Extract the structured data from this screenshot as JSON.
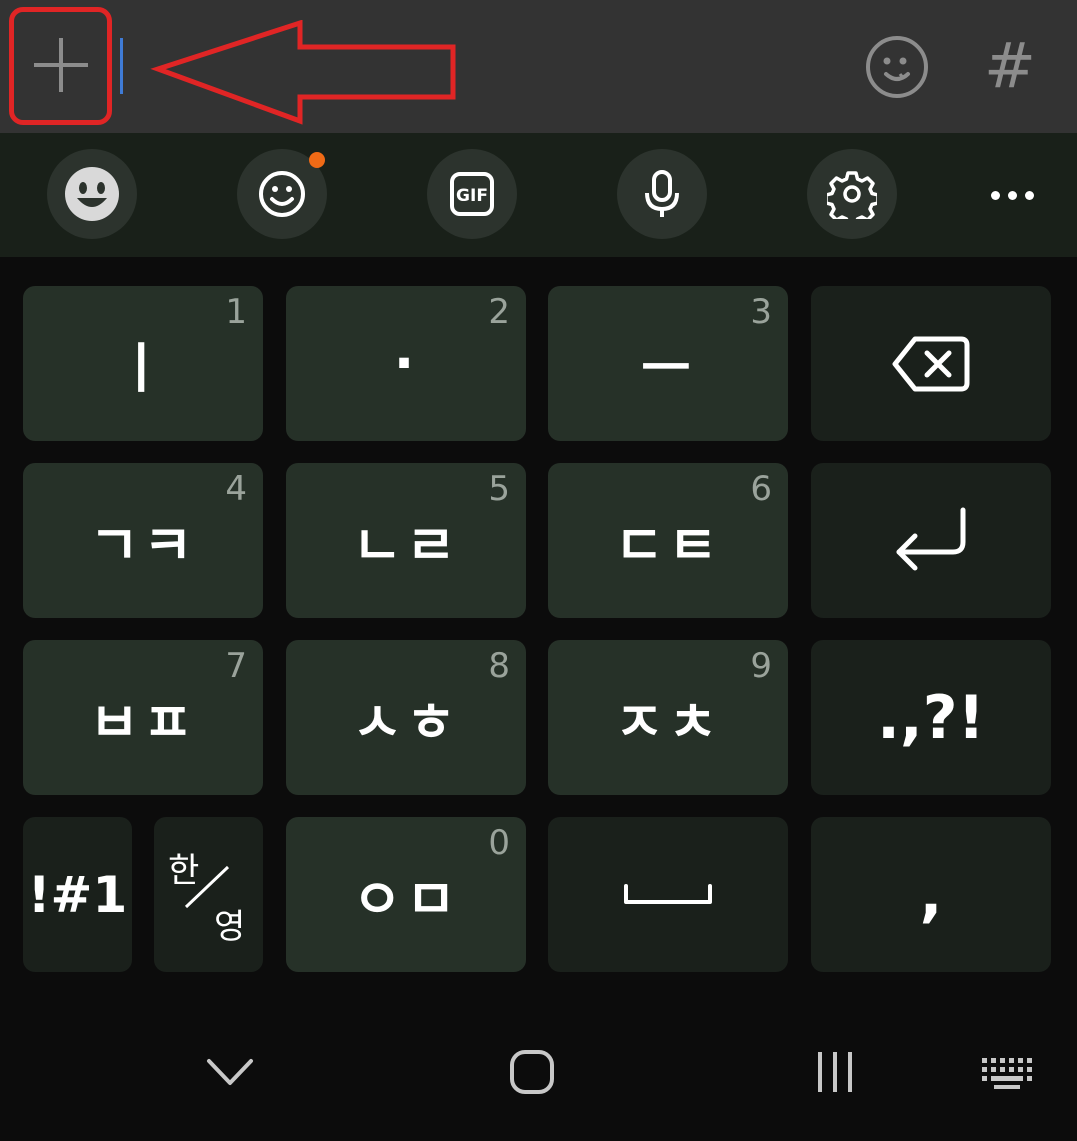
{
  "input_bar": {
    "hash_label": "#"
  },
  "toolbar": {
    "gif_label": "GIF",
    "items": [
      "emoji-icon",
      "sticker-icon",
      "gif-icon",
      "microphone-icon",
      "settings-icon",
      "more-icon"
    ]
  },
  "keys": {
    "row1": [
      {
        "main": "ㅣ",
        "num": "1"
      },
      {
        "main": "·",
        "num": "2"
      },
      {
        "main": "ㅡ",
        "num": "3"
      }
    ],
    "row2": [
      {
        "main": "ㄱㅋ",
        "num": "4"
      },
      {
        "main": "ㄴㄹ",
        "num": "5"
      },
      {
        "main": "ㄷㅌ",
        "num": "6"
      }
    ],
    "row3": [
      {
        "main": "ㅂㅍ",
        "num": "7"
      },
      {
        "main": "ㅅㅎ",
        "num": "8"
      },
      {
        "main": "ㅈㅊ",
        "num": "9"
      }
    ],
    "punct": ".,?!",
    "symbols": "!#1",
    "han": "한",
    "yeong": "영",
    "row4_center": {
      "main": "ㅇㅁ",
      "num": "0"
    },
    "comma": ","
  },
  "colors": {
    "highlight": "#e02525",
    "key": "#263128",
    "key_dark": "#1a201b",
    "badge": "#ef6a16"
  }
}
